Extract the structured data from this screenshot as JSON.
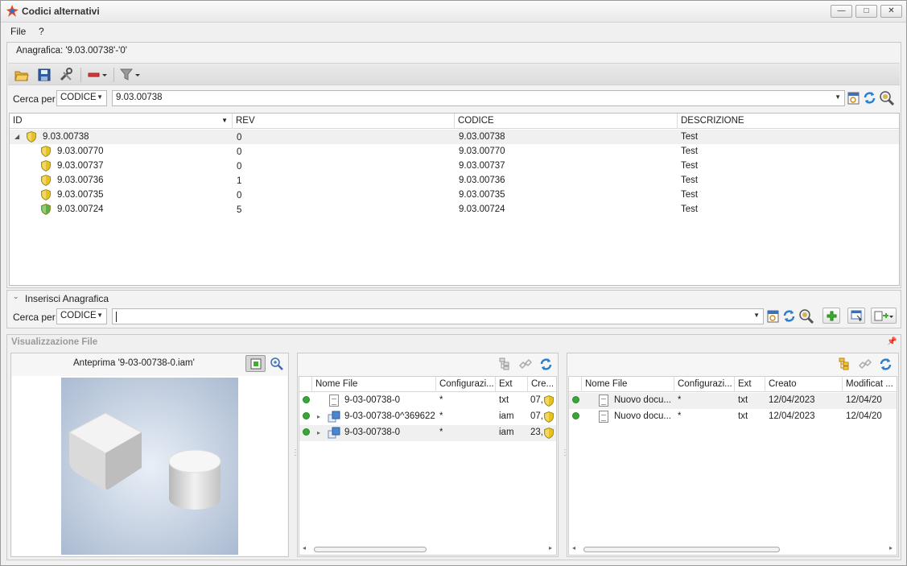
{
  "window": {
    "title": "Codici alternativi",
    "minimize": "—",
    "maximize": "□",
    "close": "✕"
  },
  "menu": {
    "file": "File",
    "help": "?"
  },
  "anagrafica_label": "Anagrafica: '9.03.00738'-'0'",
  "search_top": {
    "label": "Cerca per",
    "field": "CODICE",
    "value": "9.03.00738"
  },
  "main_grid": {
    "columns": [
      "ID",
      "REV",
      "CODICE",
      "DESCRIZIONE"
    ],
    "rows": [
      {
        "id": "9.03.00738",
        "rev": "0",
        "codice": "9.03.00738",
        "descrizione": "Test",
        "color": "#e8c21a"
      },
      {
        "id": "9.03.00770",
        "rev": "0",
        "codice": "9.03.00770",
        "descrizione": "Test",
        "color": "#e8c21a"
      },
      {
        "id": "9.03.00737",
        "rev": "0",
        "codice": "9.03.00737",
        "descrizione": "Test",
        "color": "#e8c21a"
      },
      {
        "id": "9.03.00736",
        "rev": "1",
        "codice": "9.03.00736",
        "descrizione": "Test",
        "color": "#e8c21a"
      },
      {
        "id": "9.03.00735",
        "rev": "0",
        "codice": "9.03.00735",
        "descrizione": "Test",
        "color": "#e8c21a"
      },
      {
        "id": "9.03.00724",
        "rev": "5",
        "codice": "9.03.00724",
        "descrizione": "Test",
        "color": "#5bb33c"
      }
    ]
  },
  "inserisci": {
    "title": "Inserisci Anagrafica",
    "label": "Cerca per",
    "field": "CODICE",
    "value": ""
  },
  "files": {
    "title": "Visualizzazione File",
    "preview_title": "Anteprima '9-03-00738-0.iam'",
    "left_grid": {
      "columns": [
        "Nome File",
        "Configurazi...",
        "Ext",
        "Cre..."
      ],
      "rows": [
        {
          "name": "9-03-00738-0",
          "config": "*",
          "ext": "txt",
          "created": "07,"
        },
        {
          "name": "9-03-00738-0^369622",
          "config": "*",
          "ext": "iam",
          "created": "07,"
        },
        {
          "name": "9-03-00738-0",
          "config": "*",
          "ext": "iam",
          "created": "23,"
        }
      ]
    },
    "right_grid": {
      "columns": [
        "Nome File",
        "Configurazi...",
        "Ext",
        "Creato",
        "Modificat ..."
      ],
      "rows": [
        {
          "name": "Nuovo docu...",
          "config": "*",
          "ext": "txt",
          "created": "12/04/2023",
          "modified": "12/04/20"
        },
        {
          "name": "Nuovo docu...",
          "config": "*",
          "ext": "txt",
          "created": "12/04/2023",
          "modified": "12/04/20"
        }
      ]
    }
  }
}
